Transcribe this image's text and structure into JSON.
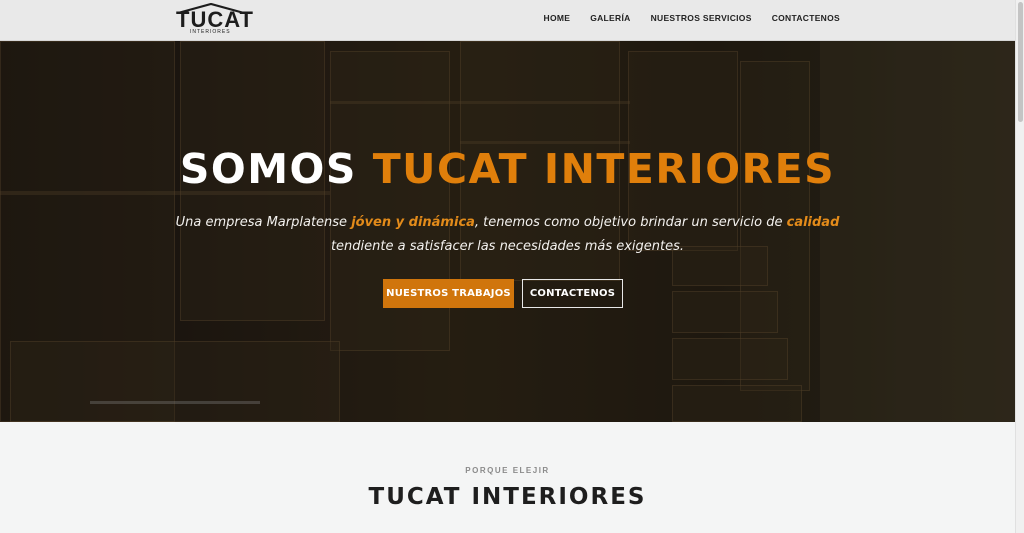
{
  "brand": {
    "logo_text": "TUCAT",
    "logo_sub": "INTERIORES"
  },
  "nav": {
    "items": [
      {
        "label": "HOME"
      },
      {
        "label": "GALERÍA"
      },
      {
        "label": "NUESTROS SERVICIOS"
      },
      {
        "label": "CONTACTENOS"
      }
    ]
  },
  "hero": {
    "title_part1": "SOMOS ",
    "title_part2": "TUCAT INTERIORES",
    "text_a": "Una empresa Marplatense ",
    "text_hl1": "jóven y dinámica",
    "text_b": ", tenemos como objetivo brindar un servicio de ",
    "text_hl2": "calidad",
    "text_c": " tendiente a satisfacer las necesidades más exigentes.",
    "btn_primary": "NUESTROS TRABAJOS",
    "btn_secondary": "CONTACTENOS"
  },
  "section": {
    "kicker": "PORQUE ELEJIR",
    "title": "TUCAT INTERIORES"
  },
  "colors": {
    "accent": "#e07f0b",
    "button": "#d0750c",
    "header_bg": "#e9e9e9",
    "section_bg": "#f4f5f5"
  }
}
